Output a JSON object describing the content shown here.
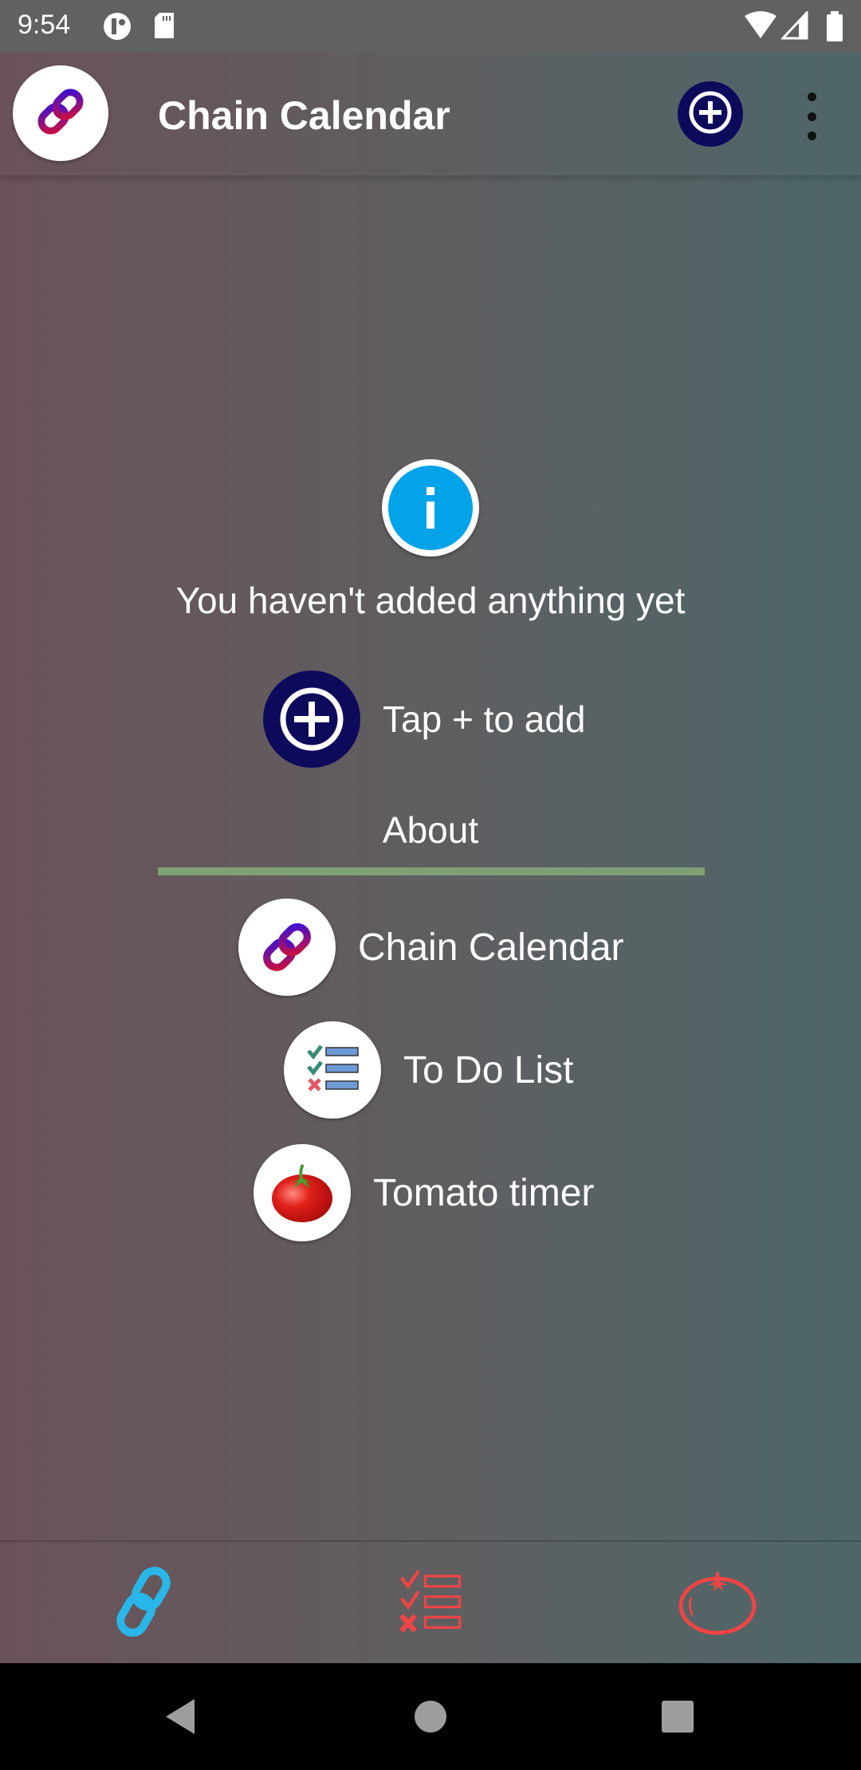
{
  "status_bar": {
    "time": "9:54",
    "left_icons": [
      "notification-app-icon",
      "sd-card-icon"
    ],
    "right_icons": [
      "wifi-icon",
      "cell-signal-icon",
      "battery-icon"
    ]
  },
  "app_bar": {
    "title": "Chain Calendar",
    "logo_icon": "chain-link-icon",
    "add_icon": "add-circle-icon",
    "menu_icon": "more-vert-icon"
  },
  "empty_state": {
    "icon": "info-icon",
    "message": "You haven't added anything yet",
    "hint": "Tap + to add"
  },
  "about": {
    "title": "About",
    "divider_color": "#7fa075",
    "items": [
      {
        "label": "Chain Calendar",
        "icon": "chain-link-icon"
      },
      {
        "label": "To Do List",
        "icon": "checklist-icon"
      },
      {
        "label": "Tomato timer",
        "icon": "tomato-icon"
      }
    ]
  },
  "bottom_nav": {
    "items": [
      {
        "name": "chain-calendar",
        "icon": "chain-link-icon",
        "color": "#29b6e8",
        "active": true
      },
      {
        "name": "to-do-list",
        "icon": "checklist-icon",
        "color": "#f04444",
        "active": false
      },
      {
        "name": "tomato-timer",
        "icon": "tomato-icon",
        "color": "#f04444",
        "active": false
      }
    ]
  },
  "system_nav": {
    "buttons": [
      "back",
      "home",
      "recents"
    ]
  },
  "colors": {
    "add_button": "#0d0a5c",
    "info_blue": "#03a3ea",
    "gradient_left": "#6a5259",
    "gradient_right": "#4d6668"
  }
}
